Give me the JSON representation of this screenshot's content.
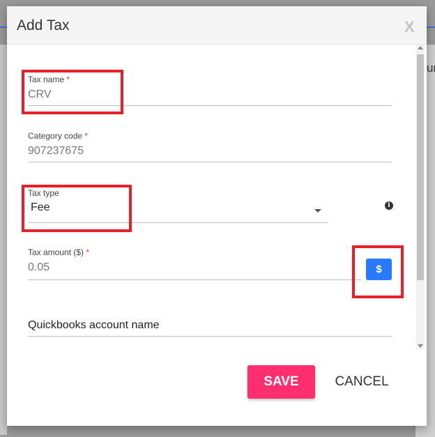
{
  "background": {
    "fragment_text": "ur"
  },
  "dialog": {
    "title": "Add Tax",
    "close_label": "X"
  },
  "form": {
    "tax_name": {
      "label": "Tax name",
      "required_mark": "*",
      "value": "CRV"
    },
    "category_code": {
      "label": "Category code",
      "required_mark": "*",
      "value": "907237675"
    },
    "tax_type": {
      "label": "Tax type",
      "value": "Fee",
      "info_icon": "info-icon"
    },
    "tax_amount": {
      "label": "Tax amount ($)",
      "required_mark": "*",
      "value": "0.05",
      "unit_button": "$"
    },
    "quickbooks": {
      "placeholder": "Quickbooks account name"
    }
  },
  "actions": {
    "save_label": "SAVE",
    "cancel_label": "CANCEL"
  },
  "colors": {
    "accent_save": "#ff2e6e",
    "accent_blue": "#2979ff",
    "highlight": "#e8202a"
  }
}
